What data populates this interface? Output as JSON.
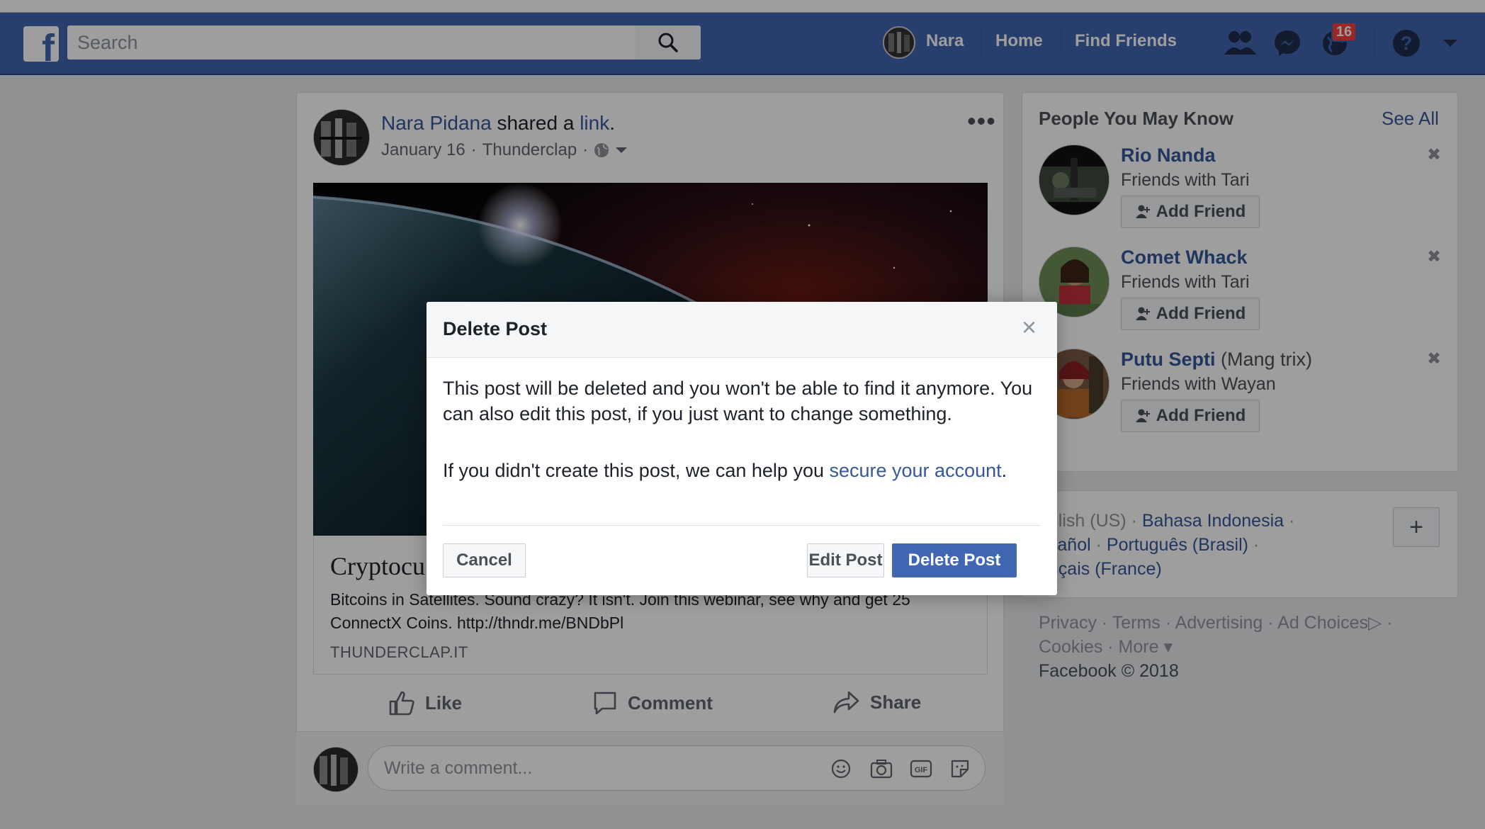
{
  "topbar": {
    "search_placeholder": "Search",
    "user_name": "Nara",
    "home_label": "Home",
    "find_friends_label": "Find Friends",
    "notifications_count": "16"
  },
  "post": {
    "author": "Nara Pidana",
    "action_text": "shared a",
    "link_word": "link",
    "period": ".",
    "date": "January 16",
    "source": "Thunderclap",
    "meta_sep": "·",
    "link_title": "Cryptocu",
    "link_description": "Bitcoins in Satellites. Sound crazy? It isn't. Join this webinar, see why and get 25 ConnectX Coins. http://thndr.me/BNDbPl",
    "link_domain": "THUNDERCLAP.IT",
    "like_label": "Like",
    "comment_label": "Comment",
    "share_label": "Share",
    "comment_placeholder": "Write a comment..."
  },
  "sidebar": {
    "pymk_title": "People You May Know",
    "see_all": "See All",
    "people": [
      {
        "name": "Rio Nanda",
        "alt": "",
        "mutual": "Friends with Tari",
        "button": "Add Friend"
      },
      {
        "name": "Comet Whack",
        "alt": "",
        "mutual": "Friends with Tari",
        "button": "Add Friend"
      },
      {
        "name": "Putu Septi",
        "alt": "(Mang trix)",
        "mutual": "Friends with Wayan",
        "button": "Add Friend"
      }
    ],
    "languages": {
      "line1_prefix": "nglish (US) · ",
      "bahasa": "Bahasa Indonesia",
      "line1_suffix": " ·",
      "espanol": "spañol",
      "sep": " · ",
      "portugues": "Português (Brasil)",
      "line2_suffix": " ·",
      "francais": "ançais (France)"
    },
    "plus_label": "+",
    "footer": {
      "privacy": "Privacy",
      "terms": "Terms",
      "advertising": "Advertising",
      "ad_choices": "Ad Choices",
      "cookies": "Cookies",
      "more": "More",
      "copyright": "Facebook © 2018"
    }
  },
  "dialog": {
    "title": "Delete Post",
    "body_text": "This post will be deleted and you won't be able to find it anymore. You can also edit this post, if you just want to change something.",
    "body2_prefix": "If you didn't create this post, we can help you ",
    "body2_link": "secure your account",
    "body2_suffix": ".",
    "cancel_label": "Cancel",
    "edit_label": "Edit Post",
    "delete_label": "Delete Post"
  },
  "colors": {
    "brand_blue": "#4267b2",
    "link_blue": "#365899",
    "badge_red": "#fa3e3e"
  }
}
